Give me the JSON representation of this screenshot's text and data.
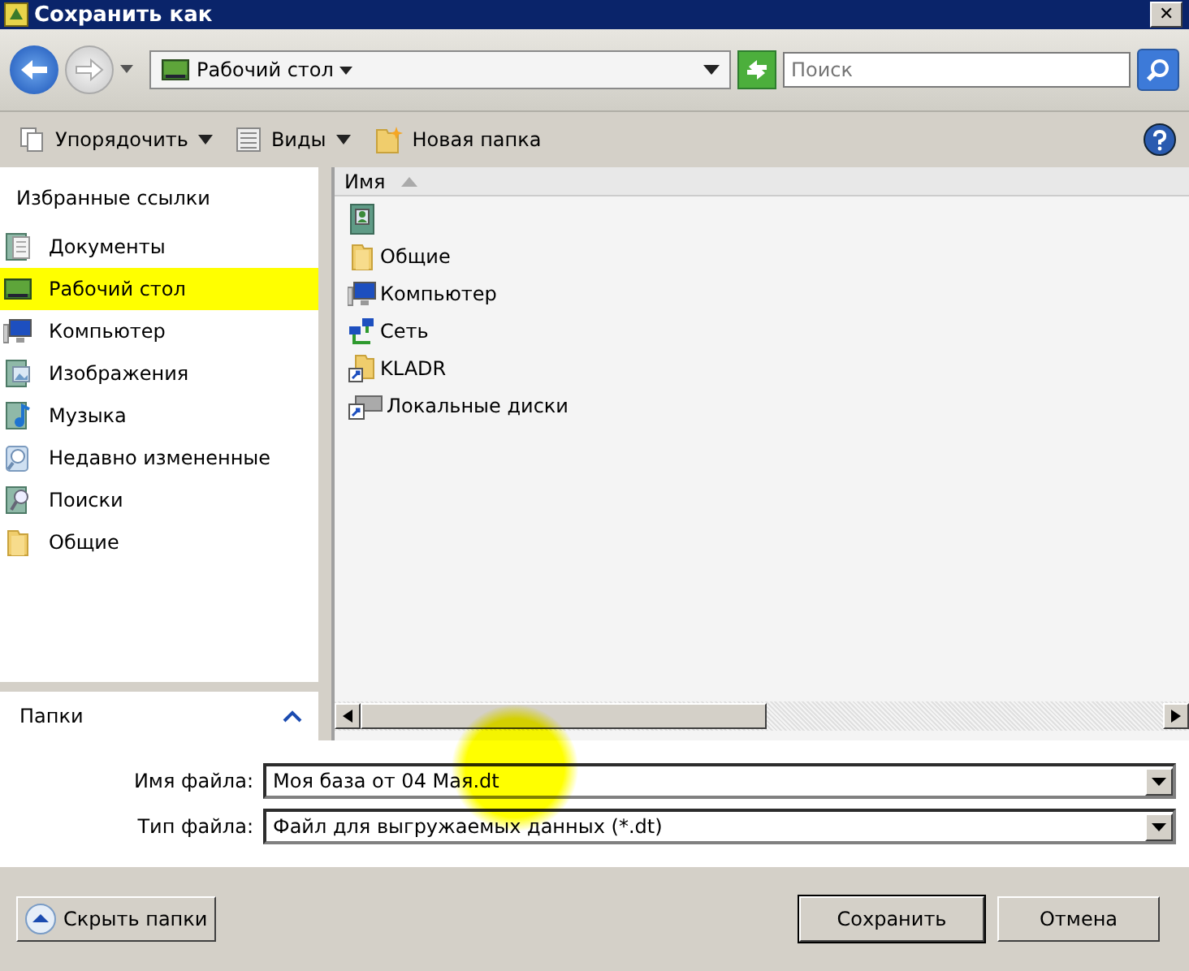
{
  "window": {
    "title": "Сохранить как",
    "close": "✕"
  },
  "navigation": {
    "location": "Рабочий стол",
    "search": {
      "placeholder": "Поиск"
    }
  },
  "toolbar": {
    "items": [
      "Упорядочить",
      "Виды",
      "Новая папка"
    ]
  },
  "sidebar": {
    "heading": "Избранные ссылки",
    "items": [
      {
        "label": "Документы",
        "selected": false
      },
      {
        "label": "Рабочий стол",
        "selected": true
      },
      {
        "label": "Компьютер",
        "selected": false
      },
      {
        "label": "Изображения",
        "selected": false
      },
      {
        "label": "Музыка",
        "selected": false
      },
      {
        "label": "Недавно измененные",
        "selected": false
      },
      {
        "label": "Поиски",
        "selected": false
      },
      {
        "label": "Общие",
        "selected": false
      }
    ],
    "folders_label": "Папки"
  },
  "file_list": {
    "column": "Имя",
    "items": [
      "Общие",
      "Компьютер",
      "Сеть",
      "KLADR",
      "Локальные диски"
    ]
  },
  "fields": [
    {
      "label": "Имя файла:",
      "value": "Моя база от 04 Мая.dt"
    },
    {
      "label": "Тип файла:",
      "value": "Файл для выгружаемых данных (*.dt)"
    }
  ],
  "buttons": {
    "hide_folders": "Скрыть папки",
    "save": "Сохранить",
    "cancel": "Отмена"
  }
}
